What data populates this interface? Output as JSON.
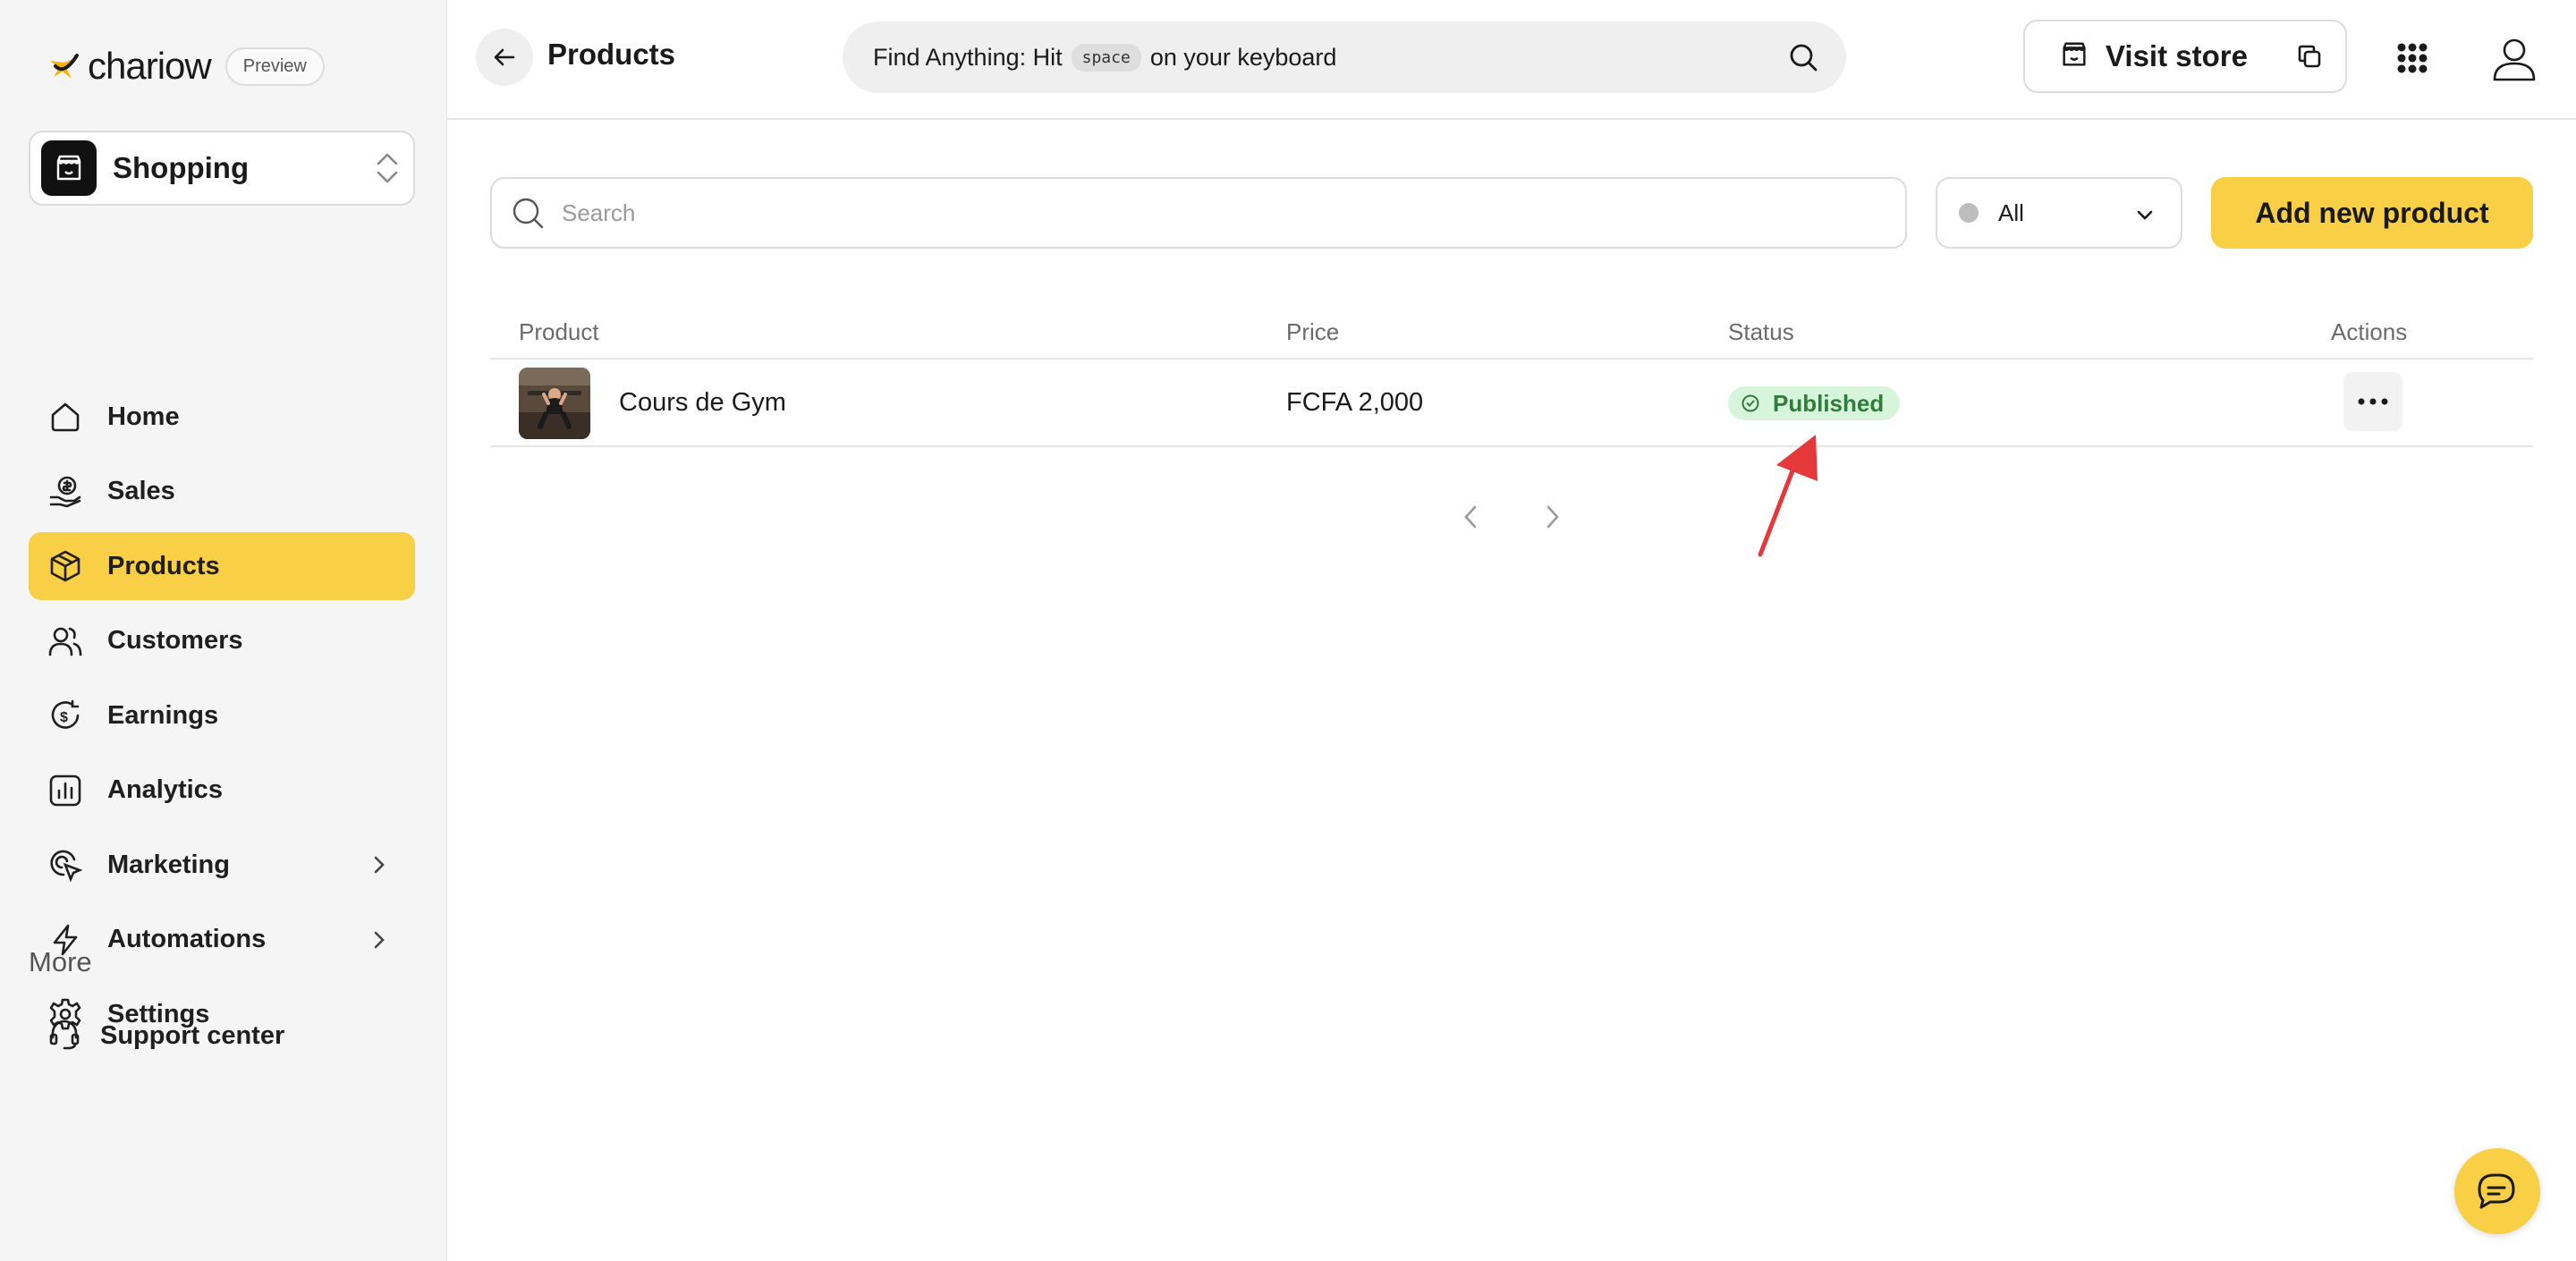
{
  "brand": {
    "name": "chariow",
    "badge": "Preview"
  },
  "store": {
    "name": "Shopping"
  },
  "sidebar": {
    "items": [
      {
        "label": "Home",
        "icon": "home-icon",
        "active": false
      },
      {
        "label": "Sales",
        "icon": "money-hand-icon",
        "active": false
      },
      {
        "label": "Products",
        "icon": "box-icon",
        "active": true
      },
      {
        "label": "Customers",
        "icon": "users-icon",
        "active": false
      },
      {
        "label": "Earnings",
        "icon": "coin-icon",
        "active": false
      },
      {
        "label": "Analytics",
        "icon": "bar-chart-icon",
        "active": false
      },
      {
        "label": "Marketing",
        "icon": "target-icon",
        "active": false,
        "expandable": true
      },
      {
        "label": "Automations",
        "icon": "lightning-icon",
        "active": false,
        "expandable": true
      },
      {
        "label": "Settings",
        "icon": "gear-icon",
        "active": false
      }
    ],
    "more_label": "More",
    "support_label": "Support center"
  },
  "header": {
    "title": "Products",
    "search_prefix": "Find Anything: Hit",
    "search_key": "space",
    "search_suffix": "on your keyboard",
    "visit_store_label": "Visit store"
  },
  "toolbar": {
    "search_placeholder": "Search",
    "status_filter": "All",
    "add_label": "Add new product"
  },
  "table": {
    "columns": [
      "Product",
      "Price",
      "Status",
      "Actions"
    ],
    "rows": [
      {
        "name": "Cours de Gym",
        "price": "FCFA 2,000",
        "status": "Published"
      }
    ]
  },
  "colors": {
    "accent": "#f8cf45",
    "published_bg": "#d7f5da",
    "published_text": "#2e7d3a",
    "annotation_arrow": "#e5383b"
  }
}
